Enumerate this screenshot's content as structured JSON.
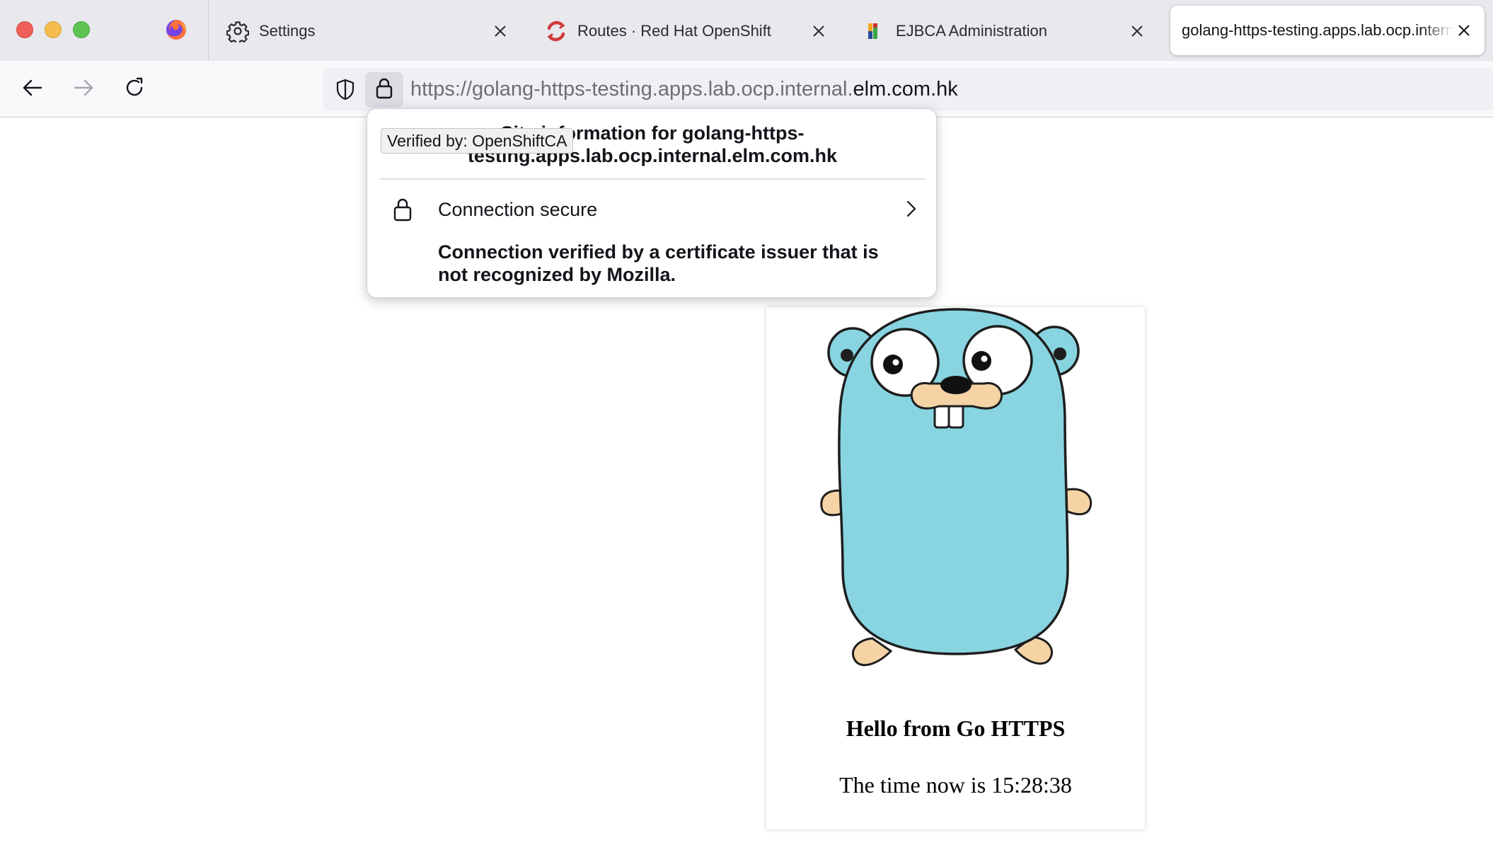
{
  "window": {
    "controls": [
      "close",
      "minimize",
      "zoom"
    ]
  },
  "tabs": [
    {
      "title": "Settings",
      "icon": "gear-icon",
      "closable": true,
      "active": false
    },
    {
      "title": "Routes · Red Hat OpenShift",
      "icon": "openshift-icon",
      "closable": true,
      "active": false
    },
    {
      "title": "EJBCA Administration",
      "icon": "ejbca-icon",
      "closable": true,
      "active": false
    },
    {
      "title": "golang-https-testing.apps.lab.ocp.internal.elm.com.hk",
      "icon": "",
      "closable": true,
      "active": true
    }
  ],
  "navbar": {
    "url_prefix": "https://golang-https-testing.apps.lab.ocp.internal.",
    "url_host": "elm.com.hk"
  },
  "site_info_popup": {
    "title": "Site information for golang-https-testing.apps.lab.ocp.internal.elm.com.hk",
    "connection_label": "Connection secure",
    "connection_detail": "Connection verified by a certificate issuer that is not recognized by Mozilla."
  },
  "tooltip": {
    "text": "Verified by: OpenShiftCA"
  },
  "page": {
    "heading": "Hello from Go HTTPS",
    "time_text": "The time now is 15:28:38"
  },
  "colors": {
    "gopher_body": "#88d5e1",
    "gopher_paws": "#f5d3a5",
    "tab_strip": "#e8e8ed",
    "openshift_red": "#d13b3b"
  }
}
